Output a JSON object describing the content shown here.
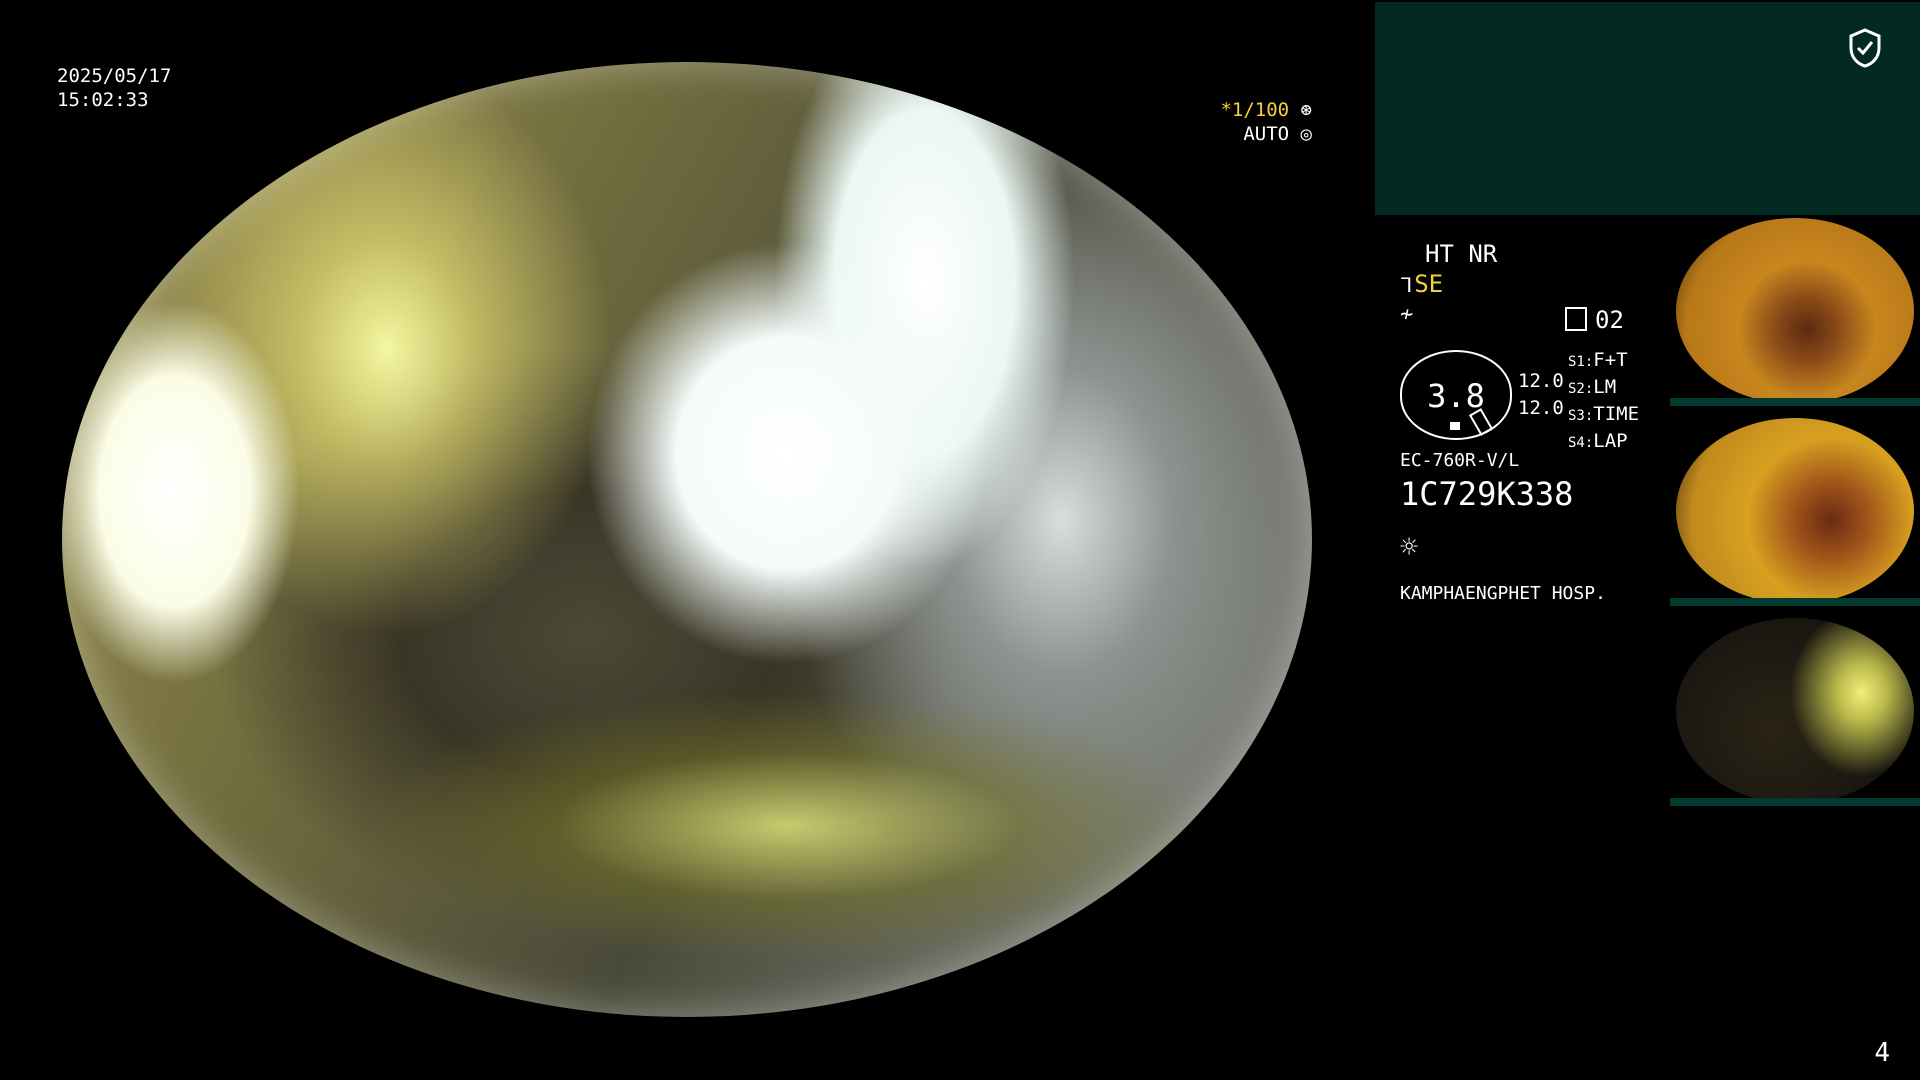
{
  "overlay": {
    "date": "2025/05/17",
    "time": "15:02:33",
    "shutter_prefix": "*",
    "shutter_speed": "1/100",
    "iris_mode": "AUTO"
  },
  "panel": {
    "mode": "HT NR",
    "enhancement": "SE",
    "index_number": "02",
    "oval_value": "3.8",
    "value_a": "12.0",
    "value_b": "12.0",
    "switches": [
      {
        "key": "S1:",
        "value": "F+T"
      },
      {
        "key": "S2:",
        "value": "LM"
      },
      {
        "key": "S3:",
        "value": "TIME"
      },
      {
        "key": "S4:",
        "value": "LAP"
      }
    ],
    "scope_model": "EC-760R-V/L",
    "scope_serial": "1C729K338",
    "hospital": "KAMPHAENGPHET HOSP."
  },
  "icons": {
    "shield": "shield-check-icon",
    "scope": "scope-icon",
    "freeze": "freeze-icon",
    "light": "light-source-icon"
  },
  "thumbnails": [
    {
      "id": "capture-1"
    },
    {
      "id": "capture-2"
    },
    {
      "id": "capture-3"
    }
  ],
  "page_number": "4",
  "colors": {
    "accent_yellow": "#f0d23a",
    "panel_green": "#022a22"
  }
}
